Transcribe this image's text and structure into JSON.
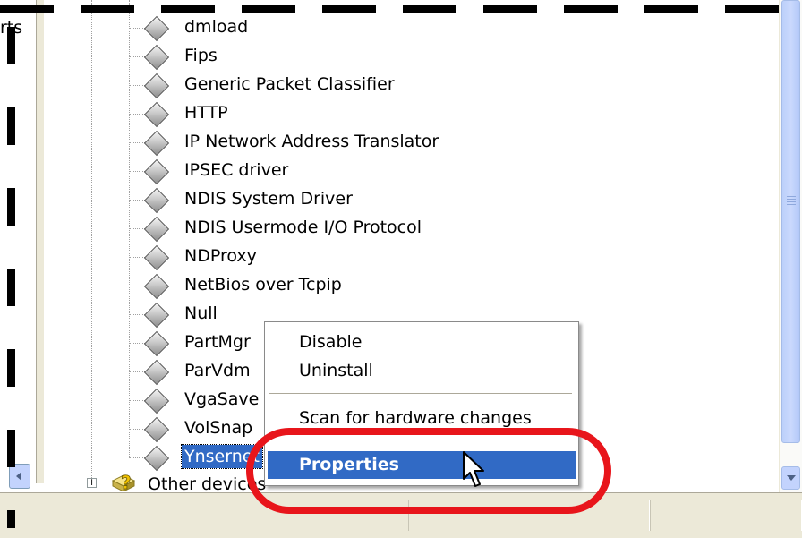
{
  "left_pane": {
    "clipped_text": "rts"
  },
  "tree": {
    "items": [
      {
        "label": "dmload"
      },
      {
        "label": "Fips"
      },
      {
        "label": "Generic Packet Classifier"
      },
      {
        "label": "HTTP"
      },
      {
        "label": "IP Network Address Translator"
      },
      {
        "label": "IPSEC driver"
      },
      {
        "label": "NDIS System Driver"
      },
      {
        "label": "NDIS Usermode I/O Protocol"
      },
      {
        "label": "NDProxy"
      },
      {
        "label": "NetBios over Tcpip"
      },
      {
        "label": "Null"
      },
      {
        "label": "PartMgr"
      },
      {
        "label": "ParVdm"
      },
      {
        "label": "VgaSave"
      },
      {
        "label": "VolSnap"
      },
      {
        "label": "Ynsernet"
      }
    ],
    "selected_item": "Ynsernet",
    "other_devices": {
      "label": "Other devices",
      "expander": "+"
    }
  },
  "context_menu": {
    "items": [
      {
        "label": "Disable"
      },
      {
        "label": "Uninstall"
      },
      {
        "label": "Scan for hardware changes"
      },
      {
        "label": "Properties"
      }
    ],
    "highlighted": "Properties"
  },
  "colors": {
    "selection": "#316ac5",
    "annotation_circle": "#e8151b",
    "status_bar": "#ece9d8",
    "scrollbar": "#c3d3fd"
  },
  "icons": {
    "device_item": "gray-diamond-icon",
    "other_devices": "yellow-question-mark-icon",
    "cursor": "mouse-pointer-icon"
  }
}
